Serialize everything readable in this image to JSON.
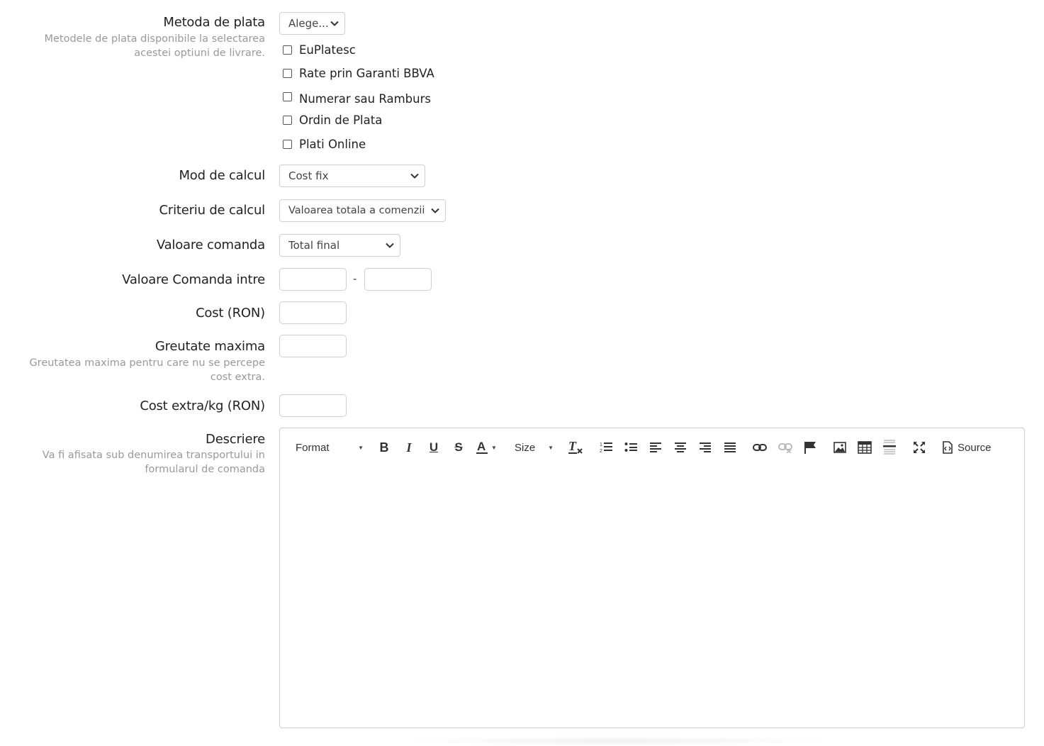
{
  "payment": {
    "label": "Metoda de plata",
    "help": "Metodele de plata disponibile la selectarea acestei optiuni de livrare.",
    "select_value": "Alege...",
    "options": [
      {
        "label": "EuPlatesc",
        "checked": false
      },
      {
        "label": "Rate prin Garanti BBVA",
        "checked": false
      },
      {
        "label": "Numerar sau Ramburs",
        "checked": false
      },
      {
        "label": "Ordin de Plata",
        "checked": false
      },
      {
        "label": "Plati Online",
        "checked": false
      }
    ]
  },
  "calc_mode": {
    "label": "Mod de calcul",
    "value": "Cost fix"
  },
  "calc_criteria": {
    "label": "Criteriu de calcul",
    "value": "Valoarea totala a comenzii"
  },
  "order_value": {
    "label": "Valoare comanda",
    "value": "Total final"
  },
  "order_range": {
    "label": "Valoare Comanda intre",
    "separator": "-",
    "from": "",
    "to": ""
  },
  "cost": {
    "label": "Cost (RON)",
    "value": ""
  },
  "max_weight": {
    "label": "Greutate maxima",
    "help": "Greutatea maxima pentru care nu se percepe cost extra.",
    "value": ""
  },
  "extra_cost": {
    "label": "Cost extra/kg (RON)",
    "value": ""
  },
  "description": {
    "label": "Descriere",
    "help": "Va fi afisata sub denumirea transportului in formularul de comanda",
    "toolbar": {
      "format_label": "Format",
      "size_label": "Size",
      "source_label": "Source"
    },
    "content": ""
  }
}
